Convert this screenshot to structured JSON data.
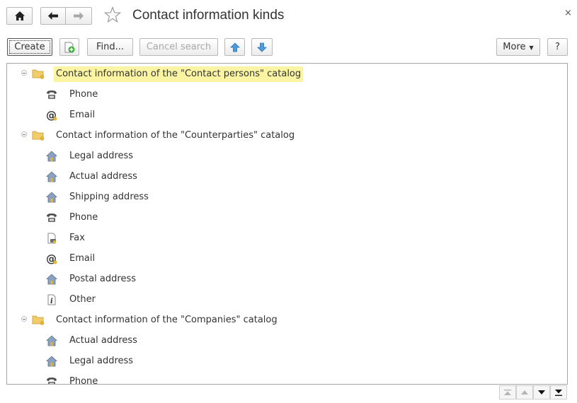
{
  "window": {
    "title": "Contact information kinds",
    "close_glyph": "×"
  },
  "toolbar": {
    "create_label": "Create",
    "find_label": "Find...",
    "cancel_search_label": "Cancel search",
    "more_label": "More",
    "help_label": "?"
  },
  "tree": {
    "groups": [
      {
        "label": "Contact information of the \"Contact persons\" catalog",
        "selected": true,
        "items": [
          {
            "label": "Phone",
            "icon": "phone-icon"
          },
          {
            "label": "Email",
            "icon": "email-icon"
          }
        ]
      },
      {
        "label": "Contact information of the \"Counterparties\" catalog",
        "selected": false,
        "items": [
          {
            "label": "Legal address",
            "icon": "address-icon"
          },
          {
            "label": "Actual address",
            "icon": "address-icon"
          },
          {
            "label": "Shipping address",
            "icon": "address-icon"
          },
          {
            "label": "Phone",
            "icon": "phone-icon"
          },
          {
            "label": "Fax",
            "icon": "fax-icon"
          },
          {
            "label": "Email",
            "icon": "email-icon"
          },
          {
            "label": "Postal address",
            "icon": "address-icon"
          },
          {
            "label": "Other",
            "icon": "other-icon"
          }
        ]
      },
      {
        "label": "Contact information of the \"Companies\" catalog",
        "selected": false,
        "items": [
          {
            "label": "Actual address",
            "icon": "address-icon"
          },
          {
            "label": "Legal address",
            "icon": "address-icon"
          },
          {
            "label": "Phone",
            "icon": "phone-icon"
          }
        ]
      }
    ]
  },
  "colors": {
    "selection": "#fbf5a3",
    "folder": "#f0cc6a",
    "arrow_button": "#4f9be0"
  }
}
